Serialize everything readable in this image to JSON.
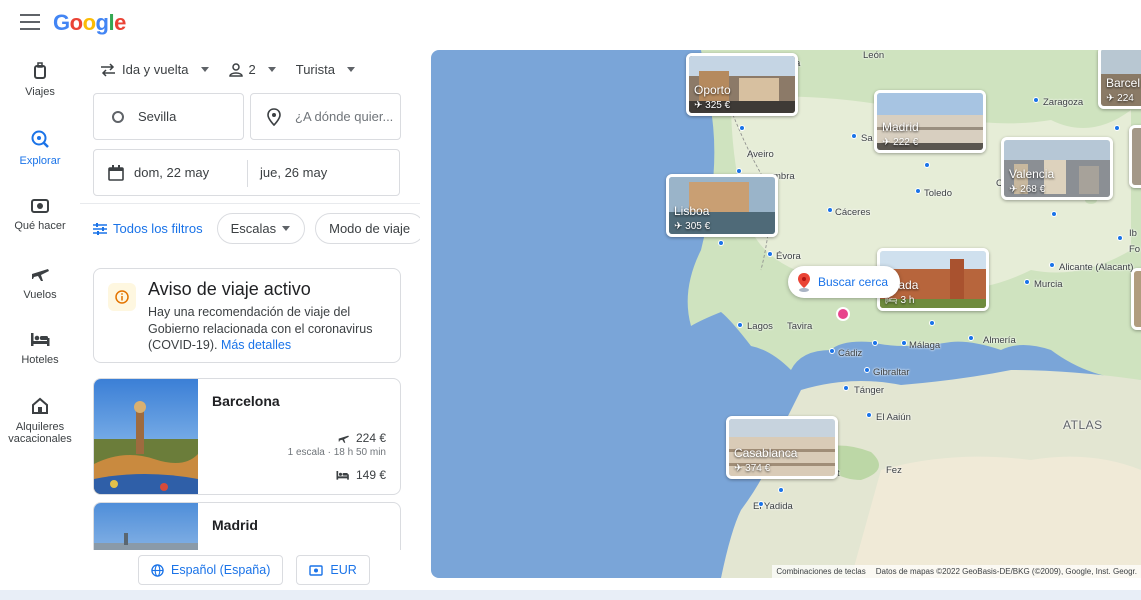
{
  "header": {
    "logo": "Google"
  },
  "nav": [
    {
      "label": "Viajes",
      "icon": "suitcase-icon"
    },
    {
      "label": "Explorar",
      "icon": "explore-icon",
      "active": true
    },
    {
      "label": "Qué hacer",
      "icon": "camera-icon"
    },
    {
      "label": "Vuelos",
      "icon": "plane-icon"
    },
    {
      "label": "Hoteles",
      "icon": "bed-icon"
    },
    {
      "label": "Alquileres vacacionales",
      "icon": "house-icon"
    }
  ],
  "search": {
    "trip_type": "Ida y vuelta",
    "passengers": "2",
    "class": "Turista",
    "origin": "Sevilla",
    "destination_placeholder": "¿A dónde quier...",
    "depart_date": "dom, 22 may",
    "return_date": "jue, 26 may"
  },
  "filters": {
    "all": "Todos los filtros",
    "stops": "Escalas",
    "mode": "Modo de viaje"
  },
  "alert": {
    "title": "Aviso de viaje activo",
    "text": "Hay una recomendación de viaje del Gobierno relacionada con el coronavirus (COVID-19). ",
    "link": "Más detalles"
  },
  "results": [
    {
      "city": "Barcelona",
      "flight_price": "224 €",
      "flight_meta": "1 escala · 18 h 50 min",
      "hotel_price": "149 €"
    },
    {
      "city": "Madrid"
    }
  ],
  "footer": {
    "language": "Español (España)",
    "currency": "EUR"
  },
  "map": {
    "tiles": [
      {
        "name": "Oporto",
        "price": "325 €"
      },
      {
        "name": "Madrid",
        "price": "222 €"
      },
      {
        "name": "Valencia",
        "price": "268 €"
      },
      {
        "name": "Lisboa",
        "price": "305 €"
      },
      {
        "name": "anada",
        "price": "3 h"
      },
      {
        "name": "Casablanca",
        "price": "374 €"
      },
      {
        "name": "Barcel",
        "price": "224"
      }
    ],
    "search_near": "Buscar cerca",
    "labels": [
      "León",
      "Zaragoza",
      "Aveiro",
      "mbra",
      "Sa",
      "Toledo",
      "Cáceres",
      "Évora",
      "Alicante (Alacant)",
      "Murcia",
      "Lagos",
      "Tavira",
      "Cádiz",
      "Málaga",
      "Almería",
      "Gibraltar",
      "Tánger",
      "El Aaiún",
      "Fez",
      "El Yadida",
      "ATLAS",
      "Ib",
      "Fo",
      "a",
      "C",
      "t"
    ],
    "attribution_shortcuts": "Combinaciones de teclas",
    "attribution": "Datos de mapas ©2022 GeoBasis-DE/BKG (©2009), Google, Inst. Geogr."
  }
}
